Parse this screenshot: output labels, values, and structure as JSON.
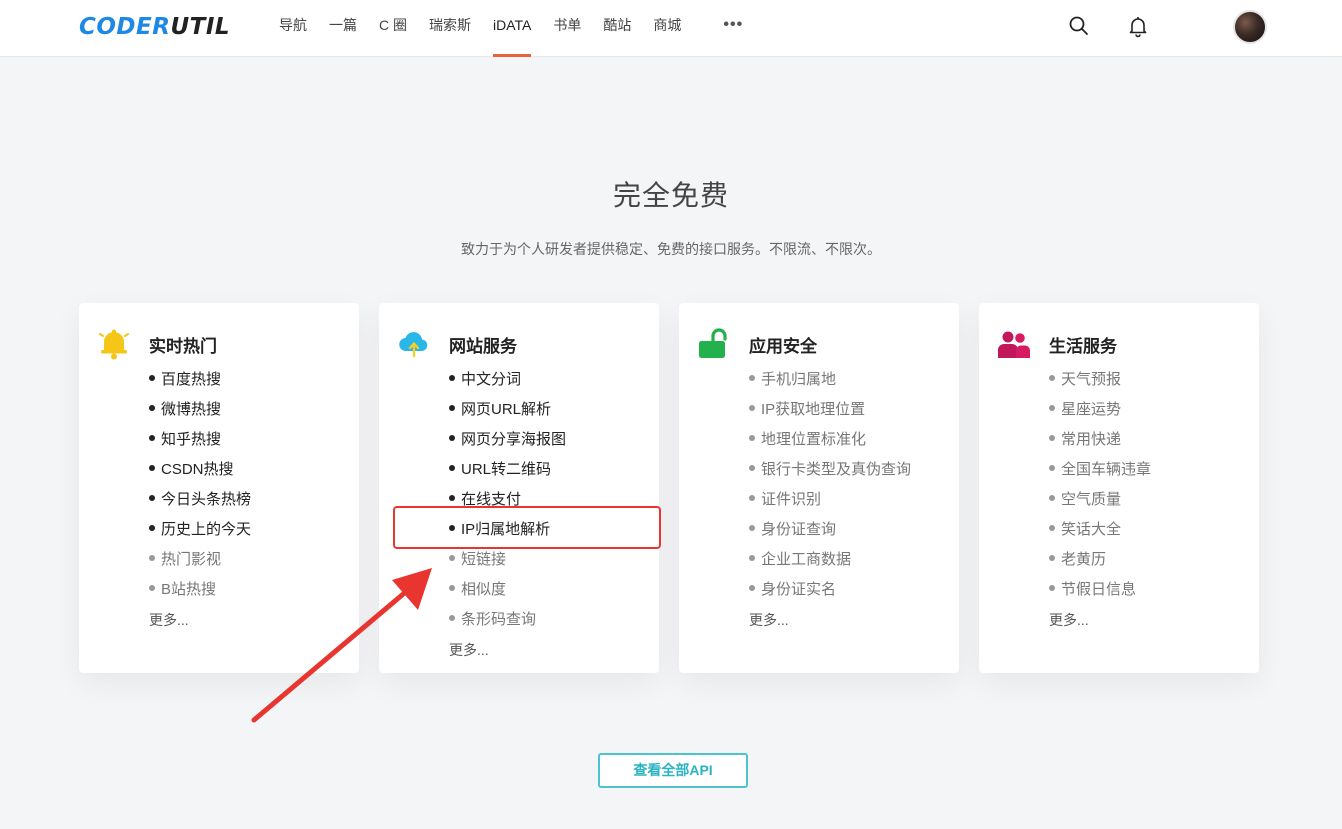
{
  "header": {
    "logo": {
      "part1": "CODER",
      "part2": "UTIL"
    },
    "nav": [
      {
        "label": "导航"
      },
      {
        "label": "一篇"
      },
      {
        "label": "C 圈"
      },
      {
        "label": "瑞索斯"
      },
      {
        "label": "iDATA",
        "active": true
      },
      {
        "label": "书单"
      },
      {
        "label": "酷站"
      },
      {
        "label": "商城"
      }
    ],
    "more_label": "•••",
    "icons": {
      "search": "search-icon",
      "notification": "bell-icon"
    }
  },
  "hero": {
    "title": "完全免费",
    "subtitle": "致力于为个人研发者提供稳定、免费的接口服务。不限流、不限次。"
  },
  "cards": [
    {
      "title": "实时热门",
      "icon": "bell-icon",
      "color": "#f5c518",
      "items": [
        "百度热搜",
        "微博热搜",
        "知乎热搜",
        "CSDN热搜",
        "今日头条热榜",
        "历史上的今天",
        "热门影视",
        "B站热搜"
      ],
      "dim_from": 6,
      "more": "更多..."
    },
    {
      "title": "网站服务",
      "icon": "cloud-upload-icon",
      "color": "#29b6e8",
      "items": [
        "中文分词",
        "网页URL解析",
        "网页分享海报图",
        "URL转二维码",
        "在线支付",
        "IP归属地解析",
        "短链接",
        "相似度",
        "条形码查询"
      ],
      "dim_from": 6,
      "more": "更多..."
    },
    {
      "title": "应用安全",
      "icon": "unlock-icon",
      "color": "#22b14c",
      "items": [
        "手机归属地",
        "IP获取地理位置",
        "地理位置标准化",
        "银行卡类型及真伪查询",
        "证件识别",
        "身份证查询",
        "企业工商数据",
        "身份证实名"
      ],
      "dim_from": 0,
      "more": "更多..."
    },
    {
      "title": "生活服务",
      "icon": "users-icon",
      "color": "#c2185b",
      "items": [
        "天气预报",
        "星座运势",
        "常用快递",
        "全国车辆违章",
        "空气质量",
        "笑话大全",
        "老黄历",
        "节假日信息"
      ],
      "dim_from": 0,
      "more": "更多..."
    }
  ],
  "cta": {
    "label": "查看全部API"
  },
  "annotation": {
    "color": "#e8352f"
  }
}
